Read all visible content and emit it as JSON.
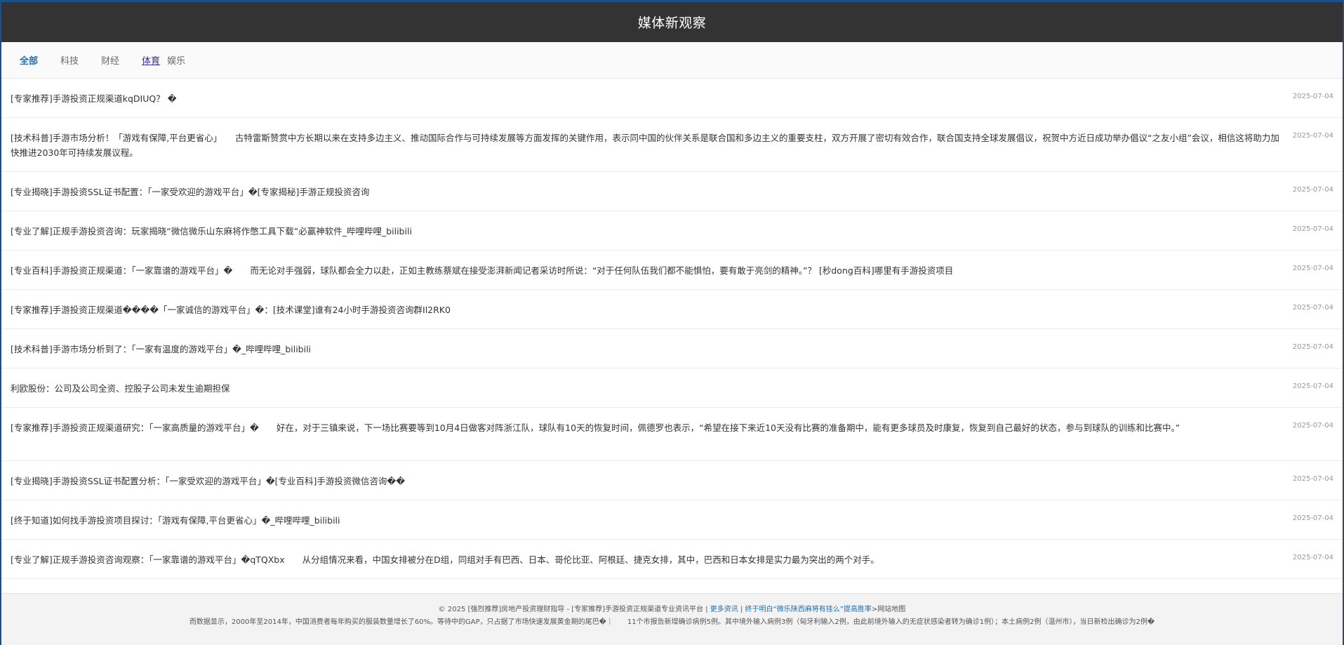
{
  "header": {
    "title": "媒体新观察"
  },
  "tabs": [
    {
      "label": "全部"
    },
    {
      "label": "科技"
    },
    {
      "label": "财经"
    },
    {
      "label": "体育"
    },
    {
      "label": "娱乐"
    }
  ],
  "articles": [
    {
      "title": "[专家推荐]手游投资正规渠道kqDIUQ？ �",
      "date": "2025-07-04"
    },
    {
      "title": "[技术科普]手游市场分析！「游戏有保障,平台更省心」　　古特雷斯赞赏中方长期以来在支持多边主义、推动国际合作与可持续发展等方面发挥的关键作用，表示同中国的伙伴关系是联合国和多边主义的重要支柱，双方开展了密切有效合作，联合国支持全球发展倡议，祝贺中方近日成功举办倡议“之友小组”会议，相信这将助力加快推进2030年可持续发展议程。",
      "date": "2025-07-04"
    },
    {
      "title": "[专业揭晓]手游投资SSL证书配置：「一家受欢迎的游戏平台」�[专家揭秘]手游正规投资咨询",
      "date": "2025-07-04"
    },
    {
      "title": "[专业了解]正规手游投资咨询：玩家揭晓“微信微乐山东麻将作憋工具下载”必赢神软件_哔哩哔哩_bilibili",
      "date": "2025-07-04"
    },
    {
      "title": "[专业百科]手游投资正规渠道：「一家靠谱的游戏平台」�　　而无论对手强弱，球队都会全力以赴，正如主教练蔡斌在接受澎湃新闻记者采访时所说：“对于任何队伍我们都不能惧怕，要有敢于亮剑的精神。”？ [秒dong百科]哪里有手游投资项目",
      "date": "2025-07-04"
    },
    {
      "title": "[专家推荐]手游投资正规渠道����「一家诚信的游戏平台」�：[技术课堂]谁有24小时手游投资咨询群Il2RK0",
      "date": "2025-07-04"
    },
    {
      "title": "[技术科普]手游市场分析到了：「一家有温度的游戏平台」�_哔哩哔哩_bilibili",
      "date": "2025-07-04"
    },
    {
      "title": "利欧股份：公司及公司全资、控股子公司未发生逾期担保",
      "date": "2025-07-04"
    },
    {
      "title": "[专家推荐]手游投资正规渠道研究：「一家高质量的游戏平台」�　　好在，对于三镇来说，下一场比赛要等到10月4日做客对阵浙江队，球队有10天的恢复时间，佩德罗也表示，“希望在接下来近10天没有比赛的准备期中，能有更多球员及时康复，恢复到自己最好的状态，参与到球队的训练和比赛中。”",
      "date": "2025-07-04"
    },
    {
      "title": "[专业揭晓]手游投资SSL证书配置分析：「一家受欢迎的游戏平台」�[专业百科]手游投资微信咨询��",
      "date": "2025-07-04"
    },
    {
      "title": "[终于知道]如何找手游投资项目探讨：「游戏有保障,平台更省心」�_哔哩哔哩_bilibili",
      "date": "2025-07-04"
    },
    {
      "title": "[专业了解]正规手游投资咨询观察：「一家靠谱的游戏平台」�qTQXbx　　从分组情况来看，中国女排被分在D组，同组对手有巴西、日本、哥伦比亚、阿根廷、捷克女排，其中，巴西和日本女排是实力最为突出的两个对手。",
      "date": "2025-07-04"
    }
  ],
  "footer": {
    "copyright": "© 2025 [强烈推荐]房地产投资理财指导 - [专家推荐]手游投资正规渠道专业资讯平台 |",
    "more_link": "更多资讯",
    "sep": "|",
    "news_link": "终于明白“微乐陕西麻将有挂么”提高胜率",
    "sitemap": ">网站地图",
    "line2": "而数据显示，2000年至2014年，中国消费者每年购买的服装数量增长了60%。等待中的GAP，只占据了市场快速发展黄金期的尾巴�｜　　11个市报告新增确诊病例5例。其中境外输入病例3例（匈牙利输入2例，由此前境外输入的无症状感染者转为确诊1例）；本土病例2例（温州市），当日新检出确诊为2例�"
  }
}
